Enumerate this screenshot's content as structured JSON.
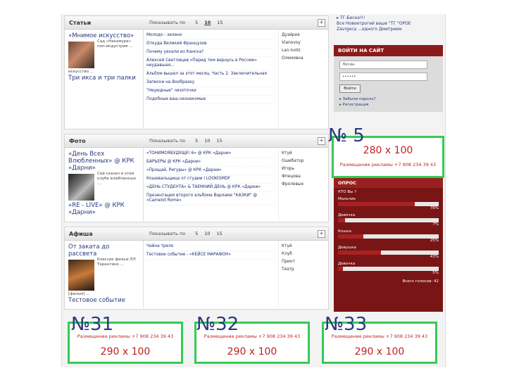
{
  "sections": {
    "articles": {
      "title": "Статьи",
      "sort_label": "Показывать по",
      "nums": [
        "5",
        "10",
        "15"
      ],
      "feature_title": "«Мнимое искусство»",
      "feature_text": "Сад «Накамура» поп-индустрия ...",
      "feature_caption": "искусство ...",
      "feature_bottom": "Три икса и три палки",
      "items": [
        "Молодо - зелено",
        "Откуда Великий Французов",
        "Почему уехали из Канска?",
        "Алексей Светлицев «Парид тем вернусь в Россию» неудавшая...",
        "Альбом вышел за этот месяц. Часть 2. Заключительная",
        "Записки на Вообразку",
        "\"Неуюдные\" чизоточки",
        "Подобные ваш незнакомые"
      ],
      "authors": [
        "Дуэйрея",
        "Vlanovoy",
        "Lan-Ivotz",
        "Олемовна"
      ]
    },
    "photo": {
      "title": "Фото",
      "sort_label": "Показывать по",
      "nums": [
        "5",
        "10",
        "15"
      ],
      "feature_title": "«День Всех Влюбленных» @ КРК «Дарни»",
      "feature_text": "Сей сказал в этом клубе влюбленных ...",
      "feature_bottom": "«RE - LIVE» @ КРК «Дарни»",
      "items": [
        "«ТОНИМОЯБУДУЩЕ! 6» @ КРК «Дарни»",
        "БАРЬЕРЫ @ КРК «Дарни»",
        "«Прощай, Ригуры» @ КРК «Дарни»",
        "Кошевальщица от студии I LOOKISMDF",
        "«ДЕНЬ СТУДЕНТА» & ТАЕМНИЙ ДЕНЬ @ КРК «Дарни»",
        "Презентация второго альбома Варламе \"КАЗКИ\" @ «Camelot Rome»"
      ],
      "authors": [
        "Ктуй",
        "Ошибатор",
        "Игорь",
        "Фпецова",
        "Фролевые"
      ]
    },
    "afisha": {
      "title": "Афиша",
      "sort_label": "Показывать по",
      "nums": [
        "5",
        "10",
        "15"
      ],
      "feature_title": "От заката до рассвета",
      "feature_text": "Классик фильм ПЛ Тарантино ...",
      "feature_caption": "[фильм] ...",
      "feature_bottom": "Тестовое событие",
      "items": [
        "Чайна трело",
        "Тестовое событие - «КЕЙСЕ МАРАФОН»"
      ],
      "authors": [
        "Ктуй",
        "Клуб",
        "Принт",
        "Театр"
      ]
    }
  },
  "sidebar": {
    "promo_lines": [
      "▸ ТГ-Бесно!!!",
      "Все Новоетрогей ваше \"ТГ \"ОРОЕ",
      "Zavrgeca ...одного Дмитрием"
    ],
    "login_title": "ВОЙТИ НА САЙТ",
    "login_value": "Логин",
    "password_value": "••••••",
    "login_button": "Войти",
    "links": [
      "▸ Забыли пароль?",
      "▸ Регистрация"
    ]
  },
  "ads": {
    "ad5": {
      "num": "№ 5",
      "size": "280 x 100",
      "place": "Размещение рекламы +7 908 234 39 43"
    },
    "ad31": {
      "num": "№31",
      "size": "290 x 100",
      "place": "Размещение рекламы +7 908 234 39 43"
    },
    "ad32": {
      "num": "№32",
      "size": "290 x 100",
      "place": "Размещение рекламы +7 908 234 39 43"
    },
    "ad33": {
      "num": "№33",
      "size": "290 x 100",
      "place": "Размещение рекламы +7 908 234 39 43"
    }
  },
  "poll": {
    "title": "ОПРОС",
    "question": "КТО Вы ?",
    "options": [
      {
        "label": "Мальчик",
        "percent": 76,
        "text": "76%"
      },
      {
        "label": "Девочка",
        "percent": 7,
        "text": "7%"
      },
      {
        "label": "Кошка",
        "percent": 25,
        "text": "25%"
      },
      {
        "label": "Девушка",
        "percent": 43,
        "text": "43%"
      },
      {
        "label": "Девочка",
        "percent": 5,
        "text": "5%"
      }
    ],
    "total": "Всего голосов: 42"
  }
}
